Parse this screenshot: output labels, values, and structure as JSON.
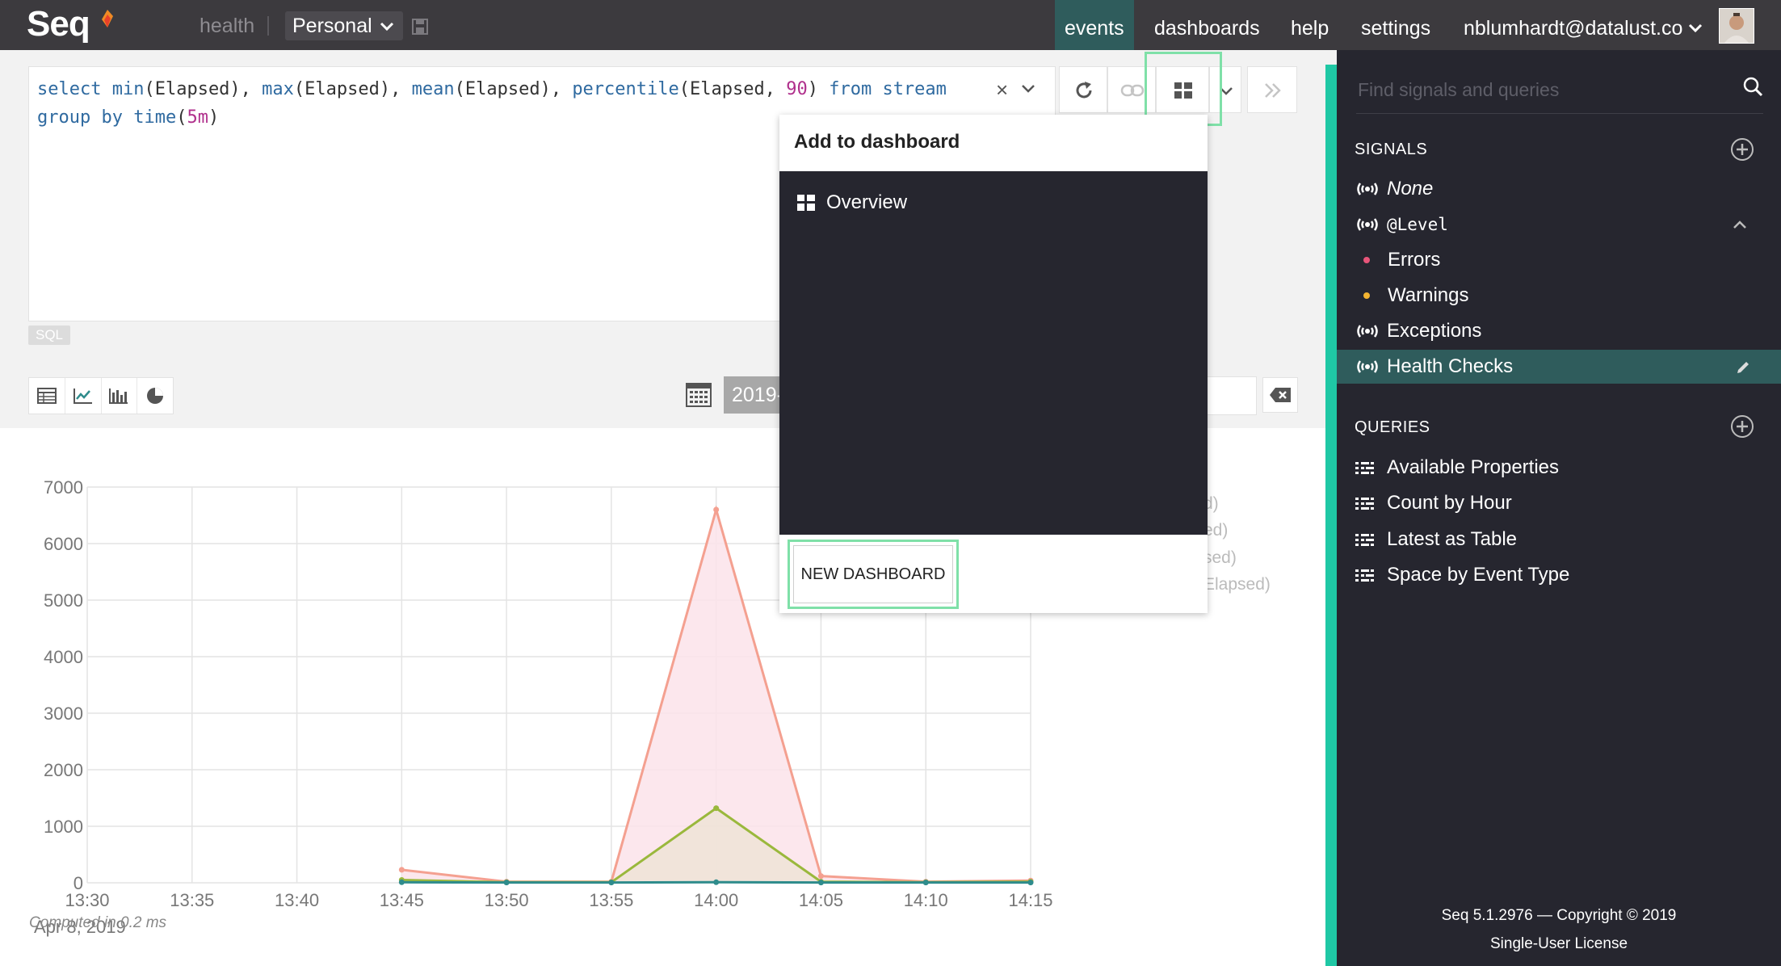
{
  "app": {
    "logo": "Seq",
    "workspace_label": "health",
    "workspace_select": "Personal"
  },
  "nav": {
    "events": "events",
    "dashboards": "dashboards",
    "help": "help",
    "settings": "settings",
    "user": "nblumhardt@datalust.co"
  },
  "query": {
    "line1_parts": [
      "select ",
      "min",
      "(Elapsed), ",
      "max",
      "(Elapsed), ",
      "mean",
      "(Elapsed), ",
      "percentile",
      "(Elapsed, ",
      "90",
      ") ",
      "from stream"
    ],
    "line2_parts": [
      "group by ",
      "time",
      "(",
      "5m",
      ")"
    ],
    "language_badge": "SQL"
  },
  "viz_toolbar": {
    "date_value": "2019-"
  },
  "dropdown": {
    "title": "Add to dashboard",
    "items": [
      {
        "label": "Overview",
        "icon": "dashboard-icon"
      }
    ],
    "new_button": "NEW DASHBOARD"
  },
  "legend_fragments": [
    "d)",
    "ed)",
    "sed)",
    "Elapsed)"
  ],
  "computed_text": "Computed in 0.2 ms",
  "sidebar": {
    "search_placeholder": "Find signals and queries",
    "signals_heading": "SIGNALS",
    "signals": [
      {
        "label": "None",
        "icon": "signal-icon",
        "italic": true
      },
      {
        "label": "@Level",
        "icon": "signal-icon",
        "mono": true
      },
      {
        "label": "Errors",
        "icon": "dot",
        "color": "#e8557a"
      },
      {
        "label": "Warnings",
        "icon": "dot",
        "color": "#f3b431"
      },
      {
        "label": "Exceptions",
        "icon": "signal-icon"
      },
      {
        "label": "Health Checks",
        "icon": "signal-icon",
        "active": true
      }
    ],
    "queries_heading": "QUERIES",
    "queries": [
      {
        "label": "Available Properties",
        "icon": "query-icon"
      },
      {
        "label": "Count by Hour",
        "icon": "query-icon"
      },
      {
        "label": "Latest as Table",
        "icon": "query-icon"
      },
      {
        "label": "Space by Event Type",
        "icon": "query-icon"
      }
    ],
    "footer_line1": "Seq 5.1.2976 — Copyright © 2019",
    "footer_line2": "Single-User License"
  },
  "chart_data": {
    "type": "line",
    "x": [
      "13:30",
      "13:35",
      "13:40",
      "13:45",
      "13:50",
      "13:55",
      "14:00",
      "14:05",
      "14:10",
      "14:15"
    ],
    "x_date_label": "Apr 8, 2019",
    "ylim": [
      0,
      7000
    ],
    "yticks": [
      0,
      1000,
      2000,
      3000,
      4000,
      5000,
      6000,
      7000
    ],
    "grid": true,
    "series": [
      {
        "color": "#f4a090",
        "fill": "#fbe3ea",
        "values": [
          null,
          null,
          null,
          230,
          20,
          20,
          6600,
          120,
          20,
          40
        ]
      },
      {
        "color": "#9ab83c",
        "fill": "#efe3d6",
        "values": [
          null,
          null,
          null,
          50,
          10,
          10,
          1320,
          20,
          10,
          20
        ]
      },
      {
        "color": "#2f8c8c",
        "fill": "none",
        "values": [
          null,
          null,
          null,
          10,
          5,
          5,
          10,
          5,
          5,
          5
        ]
      }
    ],
    "colors": {
      "grid": "#e4e4e4",
      "axis_text": "#777777"
    }
  }
}
